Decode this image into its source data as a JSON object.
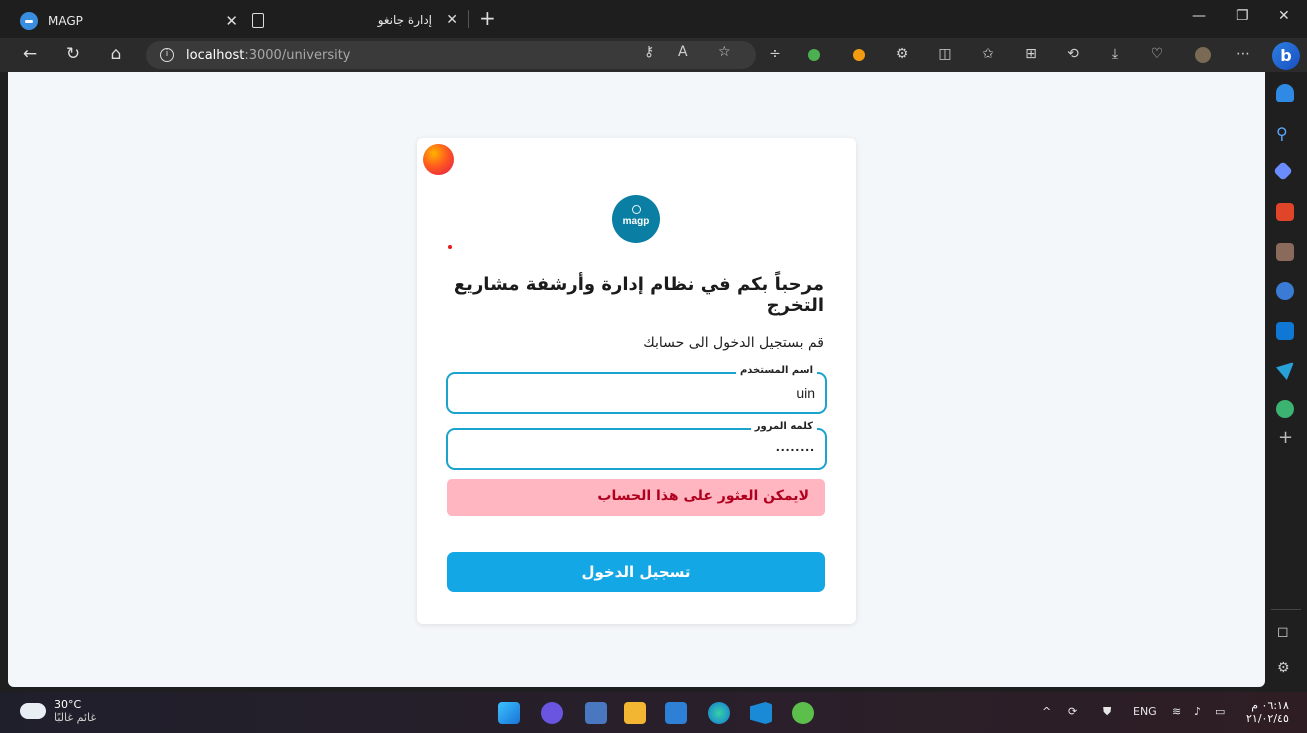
{
  "browser": {
    "active_tab_title": "MAGP",
    "second_tab_title": "إدارة جانغو",
    "url_host": "localhost",
    "url_path": ":3000/university",
    "bing_label": "b"
  },
  "page": {
    "logo_text": "magp",
    "heading": "مرحباً بكم في نظام إدارة وأرشفة مشاريع التخرج",
    "subheading": "قم بستجيل الدخول الى حسابك",
    "username_label": "اسم المستخدم",
    "username_value": "uin",
    "password_label": "كلمه المرور",
    "password_value": "........",
    "error_message": "لايمكن العثور على هذا الحساب",
    "login_button": "تسجيل الدخول"
  },
  "taskbar": {
    "weather_temp": "30°C",
    "weather_desc": "غائم غالبًا",
    "language": "ENG",
    "clock_time": "٠٦:١٨ م",
    "clock_date": "٢١/٠٢/٤٥"
  },
  "colors": {
    "accent": "#1ca3cd",
    "button": "#14a7e6",
    "error_bg": "#ffb6c1",
    "error_text": "#b0001e",
    "logo_bg": "#0b7fa3"
  }
}
